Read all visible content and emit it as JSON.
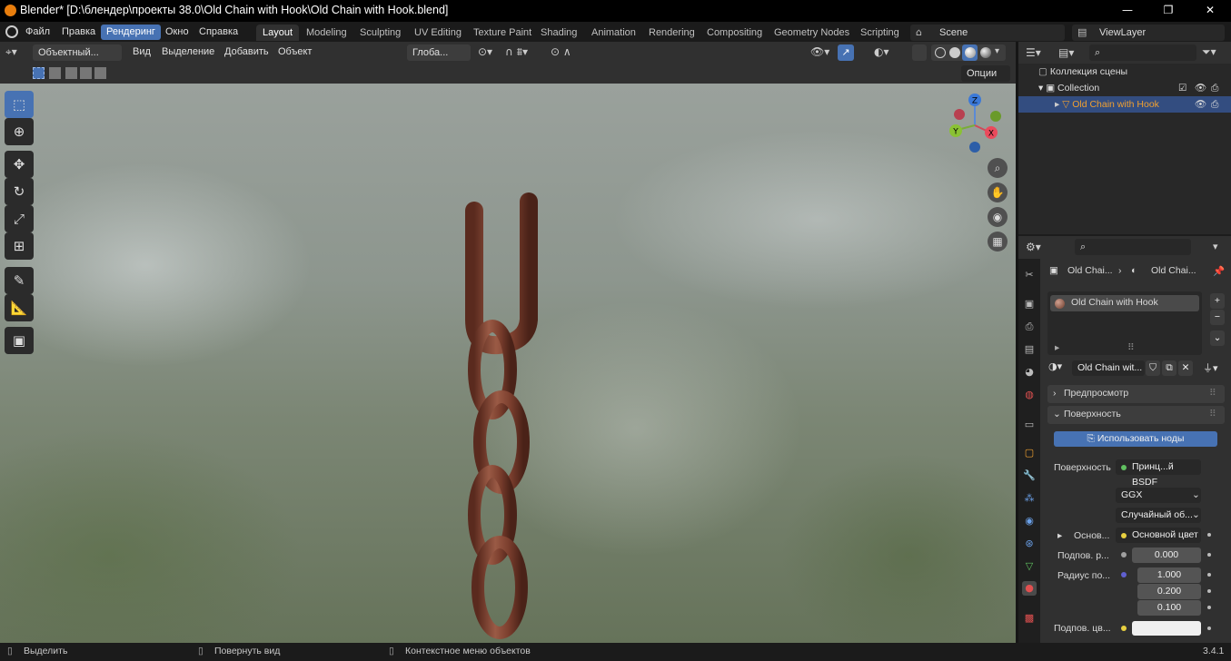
{
  "window": {
    "title": "Blender* [D:\\блендер\\проекты 38.0\\Old Chain with Hook\\Old Chain with Hook.blend]",
    "minimize": "—",
    "maximize": "❐",
    "close": "✕"
  },
  "menus": [
    "Файл",
    "Правка",
    "Рендеринг",
    "Окно",
    "Справка"
  ],
  "workspaces": [
    "Layout",
    "Modeling",
    "Sculpting",
    "UV Editing",
    "Texture Paint",
    "Shading",
    "Animation",
    "Rendering",
    "Compositing",
    "Geometry Nodes",
    "Scripting"
  ],
  "scene": "Scene",
  "viewlayer": "ViewLayer",
  "viewport_header": {
    "mode": "Объектный...",
    "view": "Вид",
    "select": "Выделение",
    "add": "Добавить",
    "object": "Объект",
    "orientation": "Глоба...",
    "options": "Опции"
  },
  "gizmo": {
    "z": "Z",
    "y": "Y",
    "x": "X"
  },
  "outliner": {
    "scene_collection": "Коллекция сцены",
    "collection": "Collection",
    "object": "Old Chain with Hook"
  },
  "properties": {
    "breadcrumb1": "Old Chai...",
    "breadcrumb2": "Old Chai...",
    "slot": "Old Chain with Hook",
    "material_name": "Old Chain wit...",
    "preview_panel": "Предпросмотр",
    "surface_panel": "Поверхность",
    "use_nodes": "Использовать ноды",
    "surface_label": "Поверхность",
    "surface_value": "Принц...й BSDF",
    "distribution": "GGX",
    "subsurface_method": "Случайный об...",
    "base_label": "Основ...",
    "base_value": "Основной цвет",
    "subsurface_label": "Подпов. р...",
    "subsurface_value": "0.000",
    "radius_label": "Радиус по...",
    "radius_values": [
      "1.000",
      "0.200",
      "0.100"
    ],
    "subsurface_color_label": "Подпов. цв..."
  },
  "status": {
    "select": "Выделить",
    "rotate": "Повернуть вид",
    "context": "Контекстное меню объектов",
    "version": "3.4.1"
  }
}
